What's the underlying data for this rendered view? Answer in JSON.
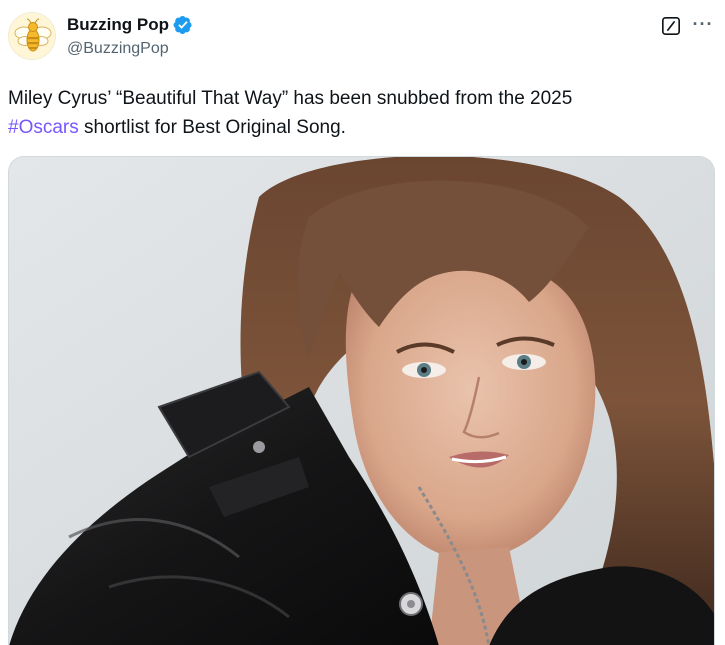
{
  "author": {
    "display_name": "Buzzing Pop",
    "handle": "@BuzzingPop",
    "verified": true,
    "avatar_icon": "bee-icon"
  },
  "actions": {
    "grok_icon": "grok-icon",
    "more_icon": "more-icon",
    "more_label": "···"
  },
  "tweet": {
    "text_line1": "Miley Cyrus’ “Beautiful That Way” has been snubbed from the 2025",
    "hashtag": "#Oscars",
    "text_line2_rest": " shortlist for Best Original Song."
  },
  "colors": {
    "hashtag": "#7856ff",
    "verified": "#1d9bf0",
    "secondary_text": "#536471"
  }
}
